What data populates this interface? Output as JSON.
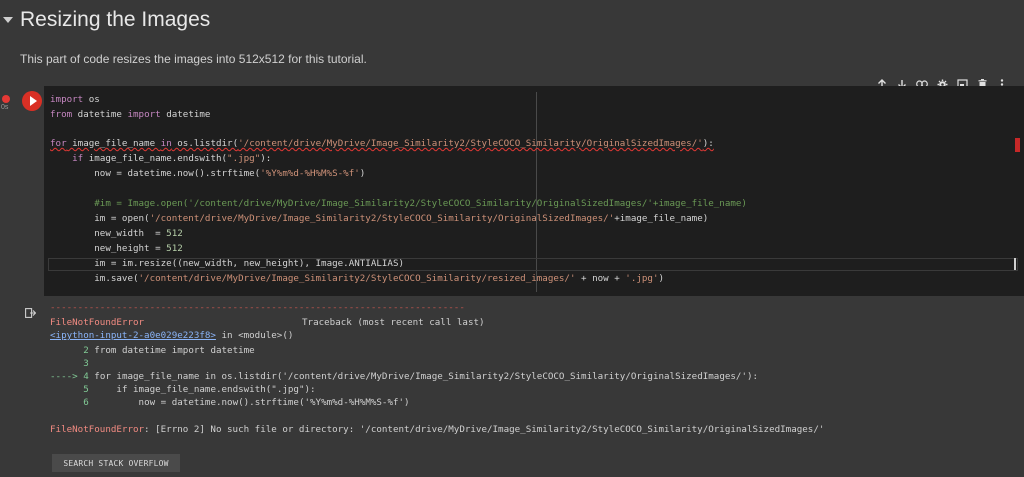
{
  "section": {
    "title": "Resizing the Images",
    "description": "This part of code resizes the images into 512x512 for this tutorial."
  },
  "toolbar": {
    "icons": [
      "arrow-up-icon",
      "arrow-down-icon",
      "link-icon",
      "gear-icon",
      "mirror-cell-icon",
      "trash-icon",
      "more-vert-icon"
    ]
  },
  "cell": {
    "exec_count": "0s",
    "code": [
      "import os",
      "from datetime import datetime",
      "",
      "for image_file_name in os.listdir('/content/drive/MyDrive/Image_Similarity2/StyleCOCO_Similarity/OriginalSizedImages/'):",
      "    if image_file_name.endswith(\".jpg\"):",
      "        now = datetime.now().strftime('%Y%m%d-%H%M%S-%f')",
      "",
      "        #im = Image.open('/content/drive/MyDrive/Image_Similarity2/StyleCOCO_Similarity/OriginalSizedImages/'+image_file_name)",
      "        im = open('/content/drive/MyDrive/Image_Similarity2/StyleCOCO_Similarity/OriginalSizedImages/'+image_file_name)",
      "        new_width  = 512",
      "        new_height = 512",
      "        im = im.resize((new_width, new_height), Image.ANTIALIAS)",
      "        im.save('/content/drive/MyDrive/Image_Similarity2/StyleCOCO_Similarity/resized_images/' + now + '.jpg')"
    ]
  },
  "output": {
    "separator": "---------------------------------------------------------------------------",
    "error_name": "FileNotFoundError",
    "traceback_label": "Traceback (most recent call last)",
    "ipython_link": "<ipython-input-2-a0e029e223f8>",
    "in_module": " in <module>()",
    "trace_lines": [
      {
        "arrow": "      ",
        "num": "2",
        "text": " from datetime import datetime"
      },
      {
        "arrow": "      ",
        "num": "3",
        "text": ""
      },
      {
        "arrow": "----> ",
        "num": "4",
        "text": " for image_file_name in os.listdir('/content/drive/MyDrive/Image_Similarity2/StyleCOCO_Similarity/OriginalSizedImages/'):"
      },
      {
        "arrow": "      ",
        "num": "5",
        "text": "     if image_file_name.endswith(\".jpg\"):"
      },
      {
        "arrow": "      ",
        "num": "6",
        "text": "         now = datetime.now().strftime('%Y%m%d-%H%M%S-%f')"
      }
    ],
    "final_error_name": "FileNotFoundError",
    "final_error_msg": ": [Errno 2] No such file or directory: '/content/drive/MyDrive/Image_Similarity2/StyleCOCO_Similarity/OriginalSizedImages/'",
    "search_button": "SEARCH STACK OVERFLOW"
  }
}
